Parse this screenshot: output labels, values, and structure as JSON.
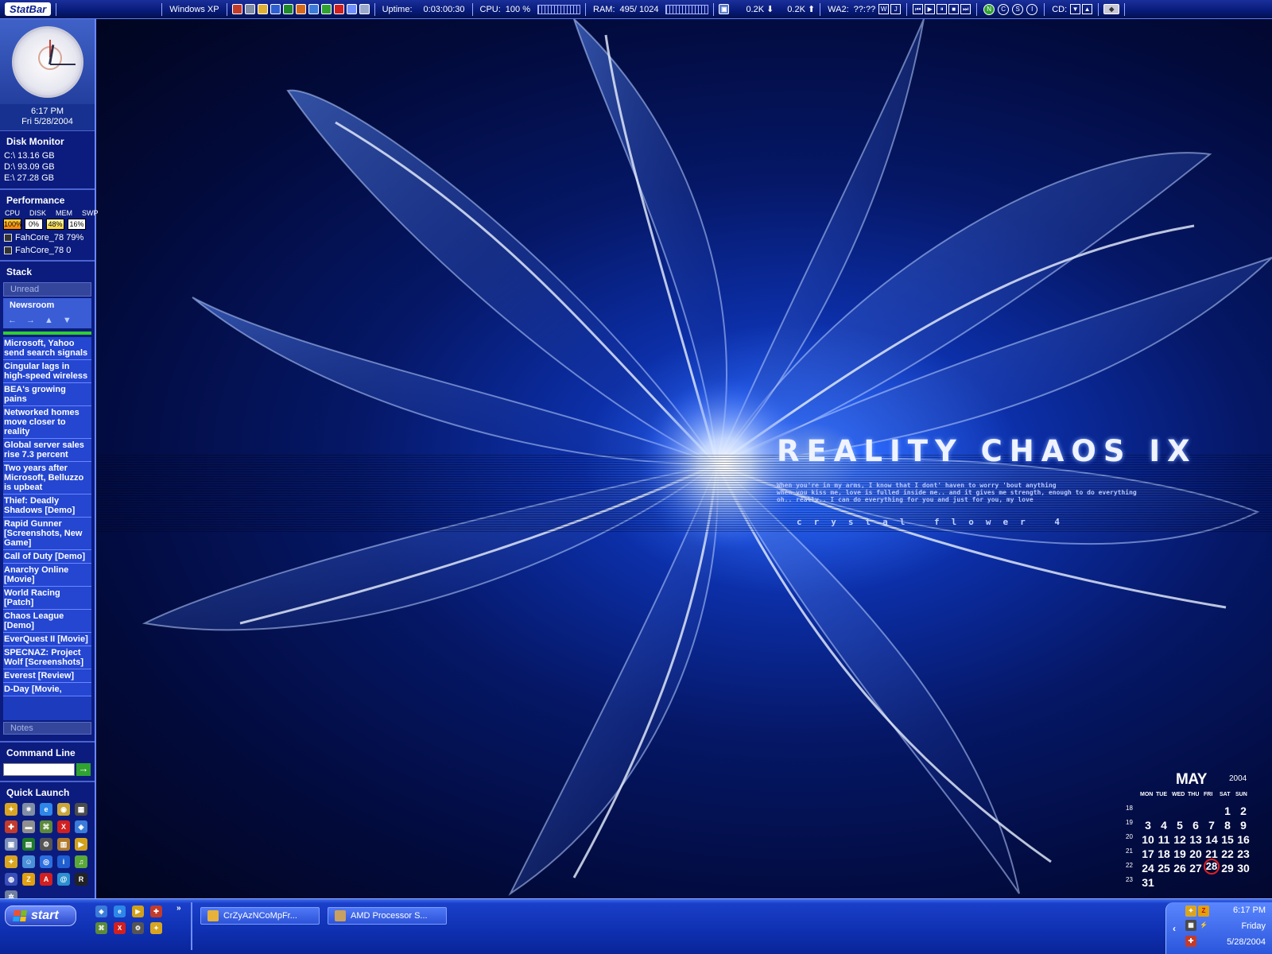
{
  "statbar": {
    "logo": "StatBar",
    "os": "Windows XP",
    "app_icons": [
      "red-app",
      "grey-app",
      "tool",
      "W",
      "X",
      "O",
      "globe",
      "green",
      "red",
      "doc",
      "page"
    ],
    "uptime_label": "Uptime:",
    "uptime_value": "0:03:00:30",
    "cpu_label": "CPU:",
    "cpu_value": "100 %",
    "ram_label": "RAM:",
    "ram_value": "495/ 1024",
    "down_rate": "0.2K",
    "up_rate": "0.2K",
    "winamp_label": "WA2:",
    "winamp_value": "??:??",
    "wa_w": "W",
    "wa_j": "J",
    "circles": [
      "N",
      "C",
      "S",
      "I"
    ],
    "cd_label": "CD:"
  },
  "sidebar": {
    "clock": {
      "time": "6:17 PM",
      "date": "Fri 5/28/2004"
    },
    "disk_monitor": {
      "title": "Disk Monitor",
      "drives": [
        "C:\\ 13.16 GB",
        "D:\\ 93.09 GB",
        "E:\\ 27.28 GB"
      ]
    },
    "performance": {
      "title": "Performance",
      "headers": [
        "CPU",
        "DISK",
        "MEM",
        "SWP"
      ],
      "values": [
        "100%",
        "0%",
        "48%",
        "16%"
      ],
      "processes": [
        "FahCore_78 79%",
        "FahCore_78 0"
      ]
    },
    "stack": {
      "title": "Stack",
      "unread_tab": "Unread",
      "newsroom_label": "Newsroom",
      "nav": [
        "←",
        "→",
        "▲",
        "▼"
      ],
      "news": [
        "Microsoft, Yahoo send search signals",
        "Cingular lags in high-speed wireless",
        "BEA's growing pains",
        "Networked homes move closer to reality",
        "Global server sales rise 7.3 percent",
        "Two years after Microsoft, Belluzzo is upbeat",
        "Thief: Deadly Shadows [Demo]",
        "Rapid Gunner [Screenshots, New Game]",
        "Call of Duty [Demo]",
        "Anarchy Online [Movie]",
        "World Racing [Patch]",
        "Chaos League [Demo]",
        "EverQuest II [Movie]",
        "SPECNAZ: Project Wolf [Screenshots]",
        "Everest [Review]",
        "D-Day [Movie,"
      ],
      "notes_tab": "Notes"
    },
    "command_line": {
      "title": "Command Line",
      "value": "",
      "go": "→"
    },
    "quick_launch": {
      "title": "Quick Launch",
      "icons": [
        {
          "name": "runner",
          "glyph": "✦",
          "color": "#d9a521"
        },
        {
          "name": "spider",
          "glyph": "✷",
          "color": "#7f8da6"
        },
        {
          "name": "internet-explorer",
          "glyph": "e",
          "color": "#2d86e8"
        },
        {
          "name": "camera",
          "glyph": "◉",
          "color": "#c9a637"
        },
        {
          "name": "film",
          "glyph": "▦",
          "color": "#4c4c4c"
        },
        {
          "name": "red-tool",
          "glyph": "✚",
          "color": "#c33b2b"
        },
        {
          "name": "drive",
          "glyph": "▬",
          "color": "#8f8f8f"
        },
        {
          "name": "network",
          "glyph": "⌘",
          "color": "#5c8a3b"
        },
        {
          "name": "exit",
          "glyph": "X",
          "color": "#d21f1f"
        },
        {
          "name": "explorer",
          "glyph": "◈",
          "color": "#3b7bd9"
        },
        {
          "name": "monitor",
          "glyph": "▣",
          "color": "#7d8eb8"
        },
        {
          "name": "matrix",
          "glyph": "▤",
          "color": "#1f7a2a"
        },
        {
          "name": "steam",
          "glyph": "⚙",
          "color": "#555555"
        },
        {
          "name": "winrar",
          "glyph": "▥",
          "color": "#b07a2a"
        },
        {
          "name": "media-player",
          "glyph": "▶",
          "color": "#d2a11a"
        },
        {
          "name": "runner-2",
          "glyph": "✦",
          "color": "#d9a521"
        },
        {
          "name": "msn",
          "glyph": "☺",
          "color": "#4a8fd9"
        },
        {
          "name": "search",
          "glyph": "◎",
          "color": "#2d6fe0"
        },
        {
          "name": "info",
          "glyph": "i",
          "color": "#1f5fd1"
        },
        {
          "name": "itunes",
          "glyph": "♫",
          "color": "#5ba83a"
        },
        {
          "name": "blue-disc",
          "glyph": "◍",
          "color": "#3b4fb8"
        },
        {
          "name": "zonealarm",
          "glyph": "Z",
          "color": "#e0a010"
        },
        {
          "name": "acrobat",
          "glyph": "A",
          "color": "#d21f1f"
        },
        {
          "name": "swirl",
          "glyph": "@",
          "color": "#2b8fd0"
        },
        {
          "name": "reality",
          "glyph": "R",
          "color": "#222222"
        },
        {
          "name": "gear",
          "glyph": "✲",
          "color": "#6f7fa0"
        }
      ]
    }
  },
  "wallpaper": {
    "title": "REALITY CHAOS IX",
    "body_lines": [
      "When you're in my arms, I know that I dont' haven to worry 'bout anything",
      "when you kiss me, love is fulled inside me.. and it gives me strength, enough to do everything",
      "oh.. really.. I can do everything for you and just for you, my love"
    ],
    "subtitle": "crystal flower 4"
  },
  "calendar": {
    "month": "MAY",
    "year": "2004",
    "day_headers": [
      "MON",
      "TUE",
      "WED",
      "THU",
      "FRI",
      "SAT",
      "SUN"
    ],
    "weeks": [
      {
        "week": "18",
        "days": [
          "",
          "",
          "",
          "",
          "",
          "1",
          "2"
        ]
      },
      {
        "week": "19",
        "days": [
          "3",
          "4",
          "5",
          "6",
          "7",
          "8",
          "9"
        ]
      },
      {
        "week": "20",
        "days": [
          "10",
          "11",
          "12",
          "13",
          "14",
          "15",
          "16"
        ]
      },
      {
        "week": "21",
        "days": [
          "17",
          "18",
          "19",
          "20",
          "21",
          "22",
          "23"
        ]
      },
      {
        "week": "22",
        "days": [
          "24",
          "25",
          "26",
          "27",
          "28",
          "29",
          "30"
        ]
      },
      {
        "week": "23",
        "days": [
          "31",
          "",
          "",
          "",
          "",
          "",
          ""
        ]
      }
    ],
    "today": "28"
  },
  "taskbar": {
    "start_label": "start",
    "chevron": "»",
    "quick_launch": [
      {
        "name": "explorer",
        "glyph": "◈",
        "color": "#3b7bd9"
      },
      {
        "name": "internet-explorer",
        "glyph": "e",
        "color": "#2d86e8"
      },
      {
        "name": "media-player",
        "glyph": "▶",
        "color": "#d2a11a"
      },
      {
        "name": "red-tool",
        "glyph": "✚",
        "color": "#c33b2b"
      },
      {
        "name": "network",
        "glyph": "⌘",
        "color": "#5c8a3b"
      },
      {
        "name": "exit",
        "glyph": "X",
        "color": "#d21f1f"
      },
      {
        "name": "steam",
        "glyph": "⚙",
        "color": "#555555"
      },
      {
        "name": "runner",
        "glyph": "✦",
        "color": "#d9a521"
      }
    ],
    "tasks": [
      "CrZyAzNCoMpFr...",
      "AMD Processor S..."
    ],
    "tray": {
      "chevron": "‹",
      "time": "6:17 PM",
      "day": "Friday",
      "date": "5/28/2004"
    }
  }
}
